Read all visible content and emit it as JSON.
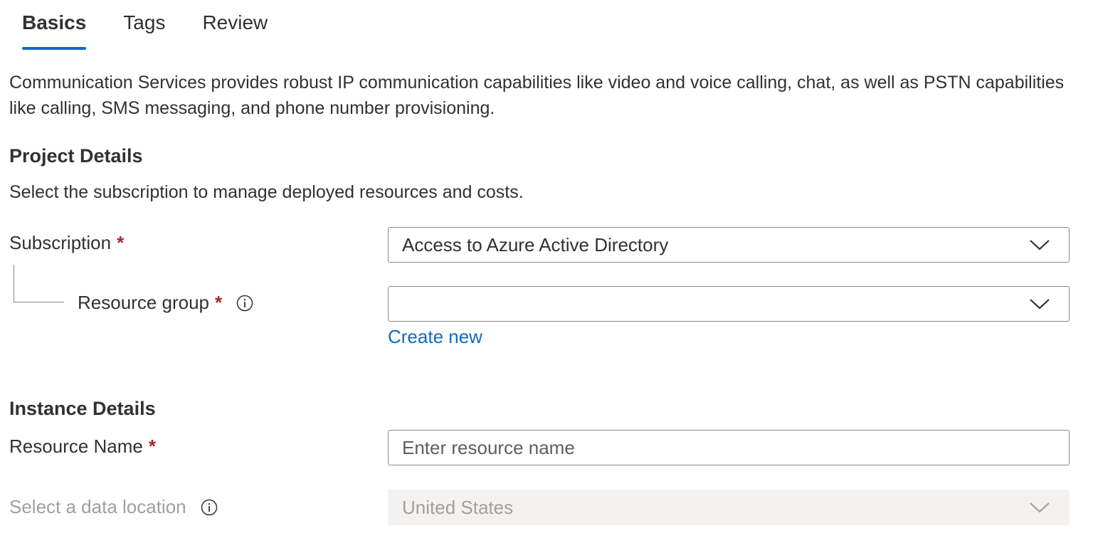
{
  "tabs": [
    {
      "label": "Basics",
      "active": true
    },
    {
      "label": "Tags",
      "active": false
    },
    {
      "label": "Review",
      "active": false
    }
  ],
  "intro_text": "Communication Services provides robust IP communication capabilities like video and voice calling, chat, as well as PSTN capabilities like calling, SMS messaging, and phone number provisioning.",
  "project_details": {
    "title": "Project Details",
    "description": "Select the subscription to manage deployed resources and costs.",
    "subscription": {
      "label": "Subscription",
      "required_mark": "*",
      "value": "Access to Azure Active Directory"
    },
    "resource_group": {
      "label": "Resource group",
      "required_mark": "*",
      "value": "",
      "create_new_label": "Create new"
    }
  },
  "instance_details": {
    "title": "Instance Details",
    "resource_name": {
      "label": "Resource Name",
      "required_mark": "*",
      "value": "",
      "placeholder": "Enter resource name"
    },
    "data_location": {
      "label": "Select a data location",
      "value": "United States",
      "disabled": true
    }
  },
  "colors": {
    "accent": "#0f6cbd",
    "required": "#a4262c",
    "text": "#323130",
    "disabled_text": "#a19f9d",
    "disabled_bg": "#f3f2f1",
    "border": "#8a8886"
  },
  "icons": {
    "info": "info-icon",
    "dropdown": "chevron-down-icon"
  }
}
